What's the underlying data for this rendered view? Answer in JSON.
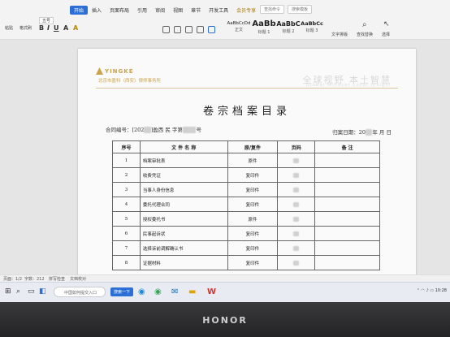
{
  "menu": {
    "tabs": [
      "开始",
      "插入",
      "页面布局",
      "引用",
      "审阅",
      "视图",
      "章节",
      "开发工具",
      "会员专享"
    ],
    "active_tab": "开始",
    "search_placeholder": "查找命令",
    "search_template": "搜索模板"
  },
  "ribbon": {
    "paste_label": "粘贴",
    "format_painter_label": "格式刷",
    "font_size": "五号",
    "styles": [
      {
        "sample": "AaBbCcDd",
        "name": "正文"
      },
      {
        "sample": "AaBb",
        "name": "标题 1"
      },
      {
        "sample": "AaBbC",
        "name": "标题 2"
      },
      {
        "sample": "AaBbCc",
        "name": "标题 3"
      }
    ],
    "text_tools_label": "文字排版",
    "find_replace_label": "查找替换",
    "select_label": "选择"
  },
  "document": {
    "logo_text": "YINGKE",
    "firm_name": "北京市盈科（西安）律师事务所",
    "motto": "全球视野 本土智慧",
    "motto_en": "Global Mindset Local Insight",
    "title": "卷宗档案目录",
    "contract_no_label": "合同编号：",
    "contract_no_prefix": "[202",
    "contract_no_mid": "]盈西 民 字第",
    "contract_no_suffix": "号",
    "filing_date_label": "归案日期：20",
    "filing_date_suffix": "年 月 日",
    "headers": [
      "序号",
      "文 件 名 称",
      "原/复件",
      "页码",
      "备 注"
    ],
    "rows": [
      {
        "no": "1",
        "name": "档案审批表",
        "type": "原件"
      },
      {
        "no": "2",
        "name": "收费凭证",
        "type": "复印件"
      },
      {
        "no": "3",
        "name": "当事人身份信息",
        "type": "复印件"
      },
      {
        "no": "4",
        "name": "委托代理合同",
        "type": "复印件"
      },
      {
        "no": "5",
        "name": "授权委托书",
        "type": "原件"
      },
      {
        "no": "6",
        "name": "民事起诉状",
        "type": "复印件"
      },
      {
        "no": "7",
        "name": "选择诉前调解确认书",
        "type": "复印件"
      },
      {
        "no": "8",
        "name": "证据材料",
        "type": "复印件"
      }
    ]
  },
  "statusbar": {
    "page": "页面：1/2",
    "words": "字数：212",
    "spell": "拼写检查",
    "proof": "文档校对"
  },
  "taskbar": {
    "search_placeholder": "中国如何提交入口",
    "search_button": "搜索一下",
    "time": "10:28"
  },
  "device_brand": "HONOR",
  "colors": {
    "accent": "#2b6fd6",
    "firm_gold": "#c9a24a"
  }
}
